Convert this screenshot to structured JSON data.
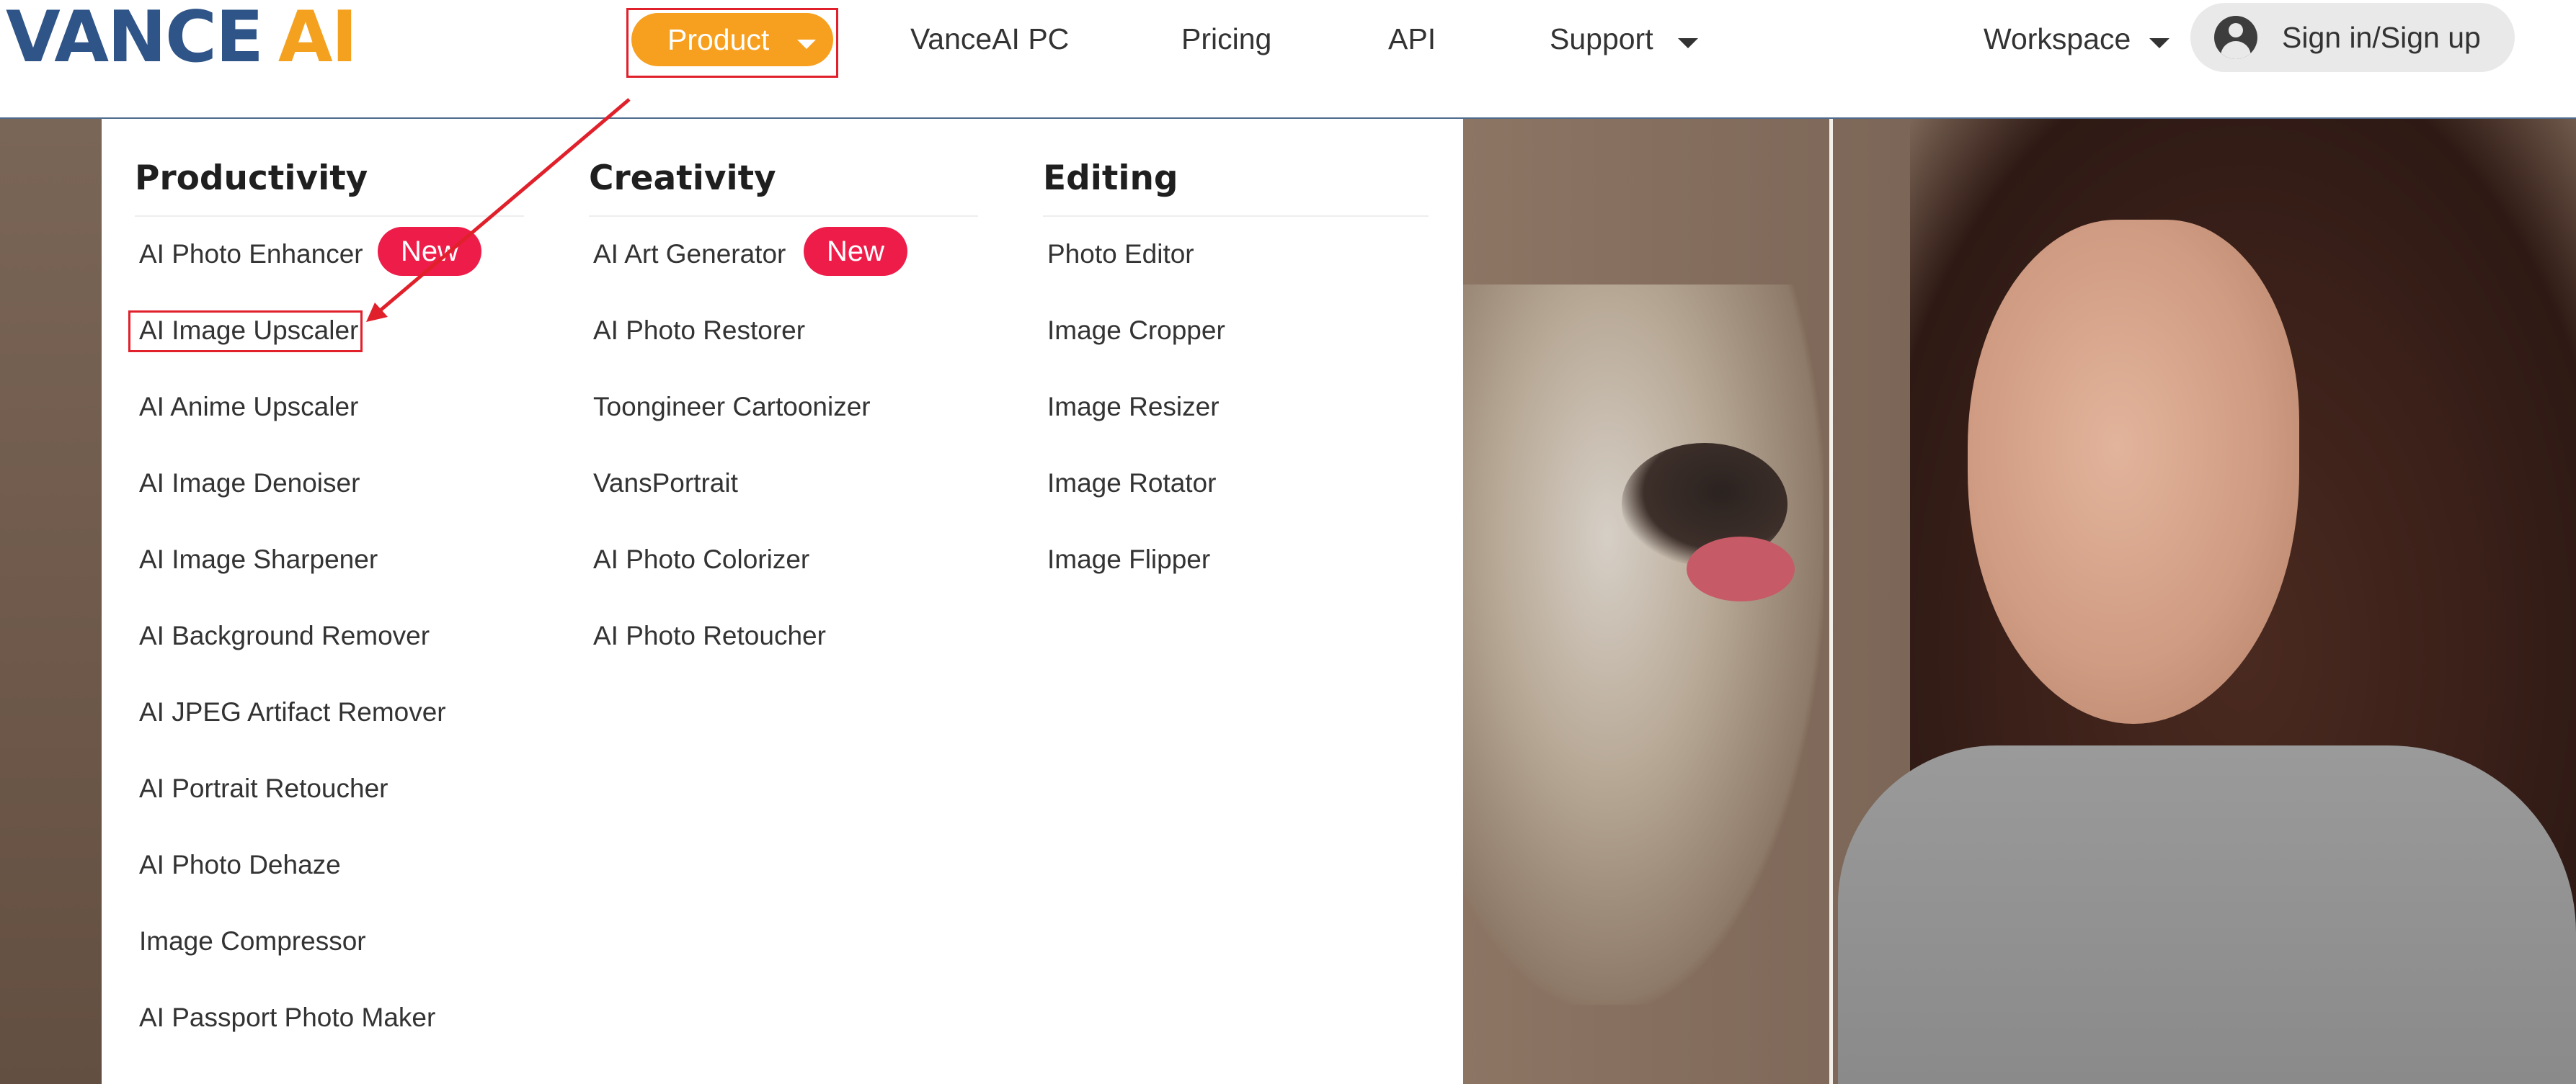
{
  "brand": {
    "logo_part1": "VANCE",
    "logo_part2": "AI"
  },
  "nav": {
    "product": "Product",
    "vanceai_pc": "VanceAI PC",
    "pricing": "Pricing",
    "api": "API",
    "support": "Support",
    "workspace": "Workspace",
    "sign_in": "Sign in/Sign up"
  },
  "menu": {
    "productivity": {
      "title": "Productivity",
      "items": [
        "AI Photo Enhancer",
        "AI Image Upscaler",
        "AI Anime Upscaler",
        "AI Image Denoiser",
        "AI Image Sharpener",
        "AI Background Remover",
        "AI JPEG Artifact Remover",
        "AI Portrait Retoucher",
        "AI Photo Dehaze",
        "Image Compressor",
        "AI Passport Photo Maker"
      ],
      "badge": "New"
    },
    "creativity": {
      "title": "Creativity",
      "items": [
        "AI Art Generator",
        "AI Photo Restorer",
        "Toongineer Cartoonizer",
        "VansPortrait",
        "AI Photo Colorizer",
        "AI Photo Retoucher"
      ],
      "badge": "New"
    },
    "editing": {
      "title": "Editing",
      "items": [
        "Photo Editor",
        "Image Cropper",
        "Image Resizer",
        "Image Rotator",
        "Image Flipper"
      ]
    }
  },
  "colors": {
    "accent": "#f7a01f",
    "logo_blue": "#2f5488",
    "badge": "#ee1c49",
    "highlight": "#e0202a"
  }
}
